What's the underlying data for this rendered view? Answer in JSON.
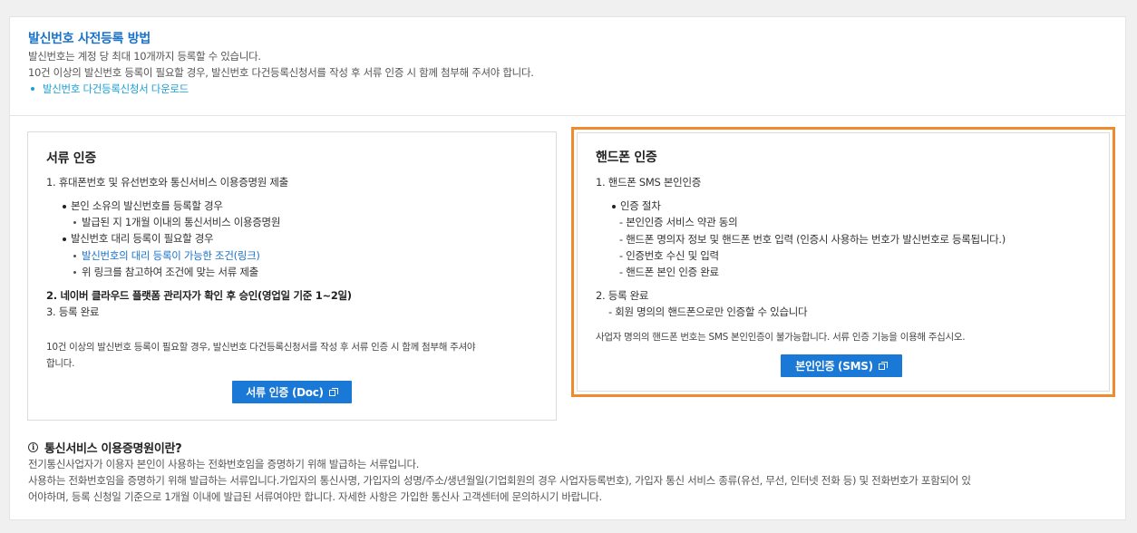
{
  "header": {
    "title": "발신번호 사전등록 방법",
    "line1": "발신번호는 계정 당 최대 10개까지 등록할 수 있습니다.",
    "line2": "10건 이상의 발신번호 등록이 필요할 경우, 발신번호 다건등록신청서를 작성 후 서류 인증 시 함께 첨부해 주셔야 합니다.",
    "download_link": "발신번호 다건등록신청서 다운로드"
  },
  "doc_card": {
    "title": "서류 인증",
    "step1": "1. 휴대폰번호 및 유선번호와 통신서비스 이용증명원 제출",
    "case1": "본인 소유의 발신번호를 등록할 경우",
    "case1_sub": "발급된 지 1개월 이내의 통신서비스 이용증명원",
    "case2": "발신번호 대리 등록이 필요할 경우",
    "case2_link": "발신번호의 대리 등록이 가능한 조건(링크)",
    "case2_sub": "위 링크를 참고하여 조건에 맞는 서류 제출",
    "step2": "2. 네이버 클라우드 플랫폼 관리자가 확인 후 승인(영업일 기준 1~2일)",
    "step3": "3. 등록 완료",
    "note_line1": "10건 이상의 발신번호 등록이 필요할 경우, 발신번호 다건등록신청서를 작성 후 서류 인증 시 함께 첨부해 주셔야",
    "note_line2": "합니다.",
    "button": "서류 인증 (Doc)"
  },
  "sms_card": {
    "title": "핸드폰 인증",
    "step1": "1. 핸드폰 SMS 본인인증",
    "procedure": "인증 절차",
    "proc1": "- 본인인증 서비스 약관 동의",
    "proc2": "- 핸드폰 명의자 정보 및 핸드폰 번호 입력 (인증시 사용하는 번호가 발신번호로 등록됩니다.)",
    "proc3": "- 인증번호 수신 및 입력",
    "proc4": "- 핸드폰 본인 인증 완료",
    "step2": "2. 등록 완료",
    "step2_sub": "- 회원 명의의 핸드폰으로만 인증할 수 있습니다",
    "note": "사업자 명의의 핸드폰 번호는 SMS 본인인증이 불가능합니다. 서류 인증 기능을 이용해 주십시오.",
    "button": "본인인증 (SMS)"
  },
  "info": {
    "icon": "info-circle-icon",
    "title": "통신서비스 이용증명원이란?",
    "line1": "전기통신사업자가 이용자 본인이 사용하는 전화번호임을 증명하기 위해 발급하는 서류입니다.",
    "line2": "사용하는 전화번호임을 증명하기 위해 발급하는 서류입니다.가입자의 통신사명, 가입자의 성명/주소/생년월일(기업회원의 경우 사업자등록번호), 가입자 통신 서비스 종류(유선, 무선, 인터넷 전화 등) 및 전화번호가 포함되어 있",
    "line3": "어야하며, 등록 신청일 기준으로 1개월 이내에 발급된 서류여야만 합니다. 자세한 사항은 가입한 통신사 고객센터에 문의하시기 바랍니다."
  },
  "colors": {
    "accent": "#1a73c8",
    "button": "#1a78d6",
    "highlight_border": "#f08a2e"
  }
}
